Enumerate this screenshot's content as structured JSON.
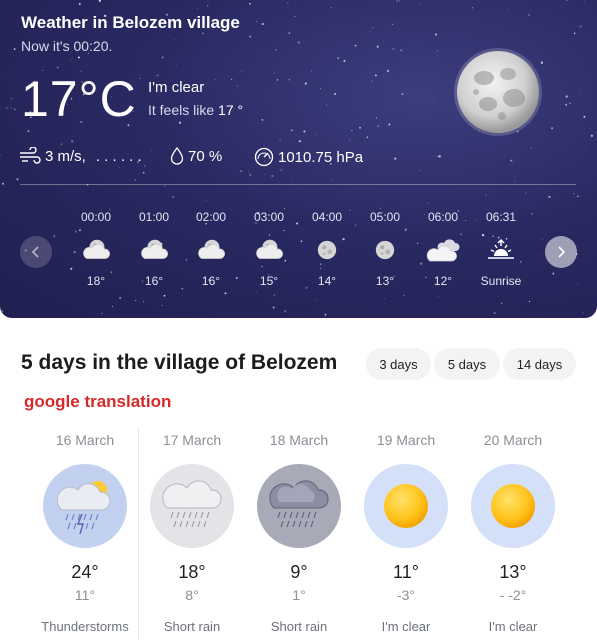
{
  "header": {
    "title": "Weather in Belozem village",
    "now": "Now it's 00:20.",
    "temperature": "17°C",
    "condition": "I'm clear",
    "feels_prefix": "It feels like",
    "feels_value": "17 °"
  },
  "metrics": {
    "wind": "3 m/s,",
    "wind_dir": ". . . . . .",
    "humidity": "70 %",
    "pressure": "1010.75 hPa"
  },
  "hourly": [
    {
      "time": "00:00",
      "icon": "moon-cloud-icon",
      "value": "18°"
    },
    {
      "time": "01:00",
      "icon": "moon-cloud-icon",
      "value": "16°"
    },
    {
      "time": "02:00",
      "icon": "moon-cloud-icon",
      "value": "16°"
    },
    {
      "time": "03:00",
      "icon": "moon-cloud-icon",
      "value": "15°"
    },
    {
      "time": "04:00",
      "icon": "moon-icon",
      "value": "14°"
    },
    {
      "time": "05:00",
      "icon": "moon-icon",
      "value": "13°"
    },
    {
      "time": "06:00",
      "icon": "cloud-icon",
      "value": "12°"
    },
    {
      "time": "06:31",
      "icon": "sunrise-icon",
      "value": "Sunrise"
    }
  ],
  "forecast": {
    "heading": "5 days in the village of Belozem",
    "tabs": [
      "3 days",
      "5 days",
      "14 days"
    ],
    "translation_note": "google translation",
    "days": [
      {
        "date": "16 March",
        "icon": "thunderstorm-icon",
        "high": "24°",
        "low": "11°",
        "desc": "Thunderstorms"
      },
      {
        "date": "17 March",
        "icon": "short-rain-icon",
        "high": "18°",
        "low": "8°",
        "desc": "Short rain"
      },
      {
        "date": "18 March",
        "icon": "short-rain-dark-icon",
        "high": "9°",
        "low": "1°",
        "desc": "Short rain"
      },
      {
        "date": "19 March",
        "icon": "sun-icon",
        "high": "11°",
        "low": "-3°",
        "desc": "I'm clear"
      },
      {
        "date": "20 March",
        "icon": "sun-icon",
        "high": "13°",
        "low": "- -2°",
        "desc": "I'm clear"
      }
    ]
  },
  "colors": {
    "night_bg": "#2a2a63",
    "translation_red": "#d62a2a",
    "sun_circle_bg": "#d4dff8",
    "storm_circle_bg": "#c3d1f0",
    "rain_circle_bg": "#e4e4e8",
    "dark_rain_circle_bg": "#a9aab8"
  }
}
